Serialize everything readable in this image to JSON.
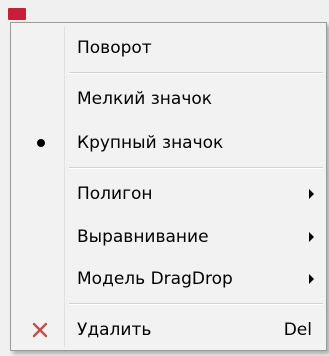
{
  "menu": {
    "items": [
      {
        "label": "Поворот"
      },
      {
        "label": "Мелкий значок"
      },
      {
        "label": "Крупный значок",
        "checked": true
      },
      {
        "label": "Полигон",
        "submenu": true
      },
      {
        "label": "Выравнивание",
        "submenu": true
      },
      {
        "label": "Модель DragDrop",
        "submenu": true
      },
      {
        "label": "Удалить",
        "shortcut": "Del",
        "icon": "delete-x-icon"
      }
    ]
  },
  "colors": {
    "menu_background": "#f2f2f2",
    "delete_icon": "#c0504d",
    "app_icon": "#c81e3a"
  }
}
